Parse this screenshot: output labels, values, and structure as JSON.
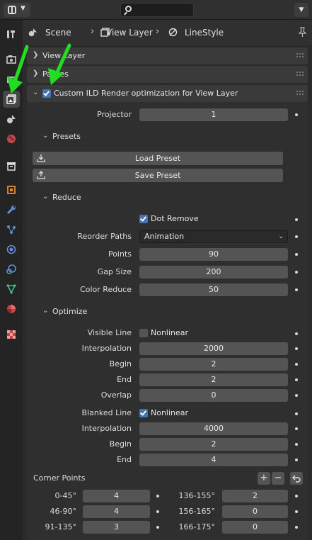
{
  "breadcrumb": {
    "scene": "Scene",
    "view_layer": "View Layer",
    "linestyle": "LineStyle"
  },
  "panels": {
    "view_layer": "View Layer",
    "passes": "Passes",
    "custom": "Custom ILD Render optimization for View Layer"
  },
  "projector": {
    "label": "Projector",
    "value": "1"
  },
  "presets": {
    "header": "Presets",
    "load": "Load Preset",
    "save": "Save Preset"
  },
  "reduce": {
    "header": "Reduce",
    "dot_remove": "Dot Remove",
    "reorder_label": "Reorder Paths",
    "reorder_value": "Animation",
    "points_label": "Points",
    "points_value": "90",
    "gap_label": "Gap Size",
    "gap_value": "200",
    "color_label": "Color Reduce",
    "color_value": "50"
  },
  "optimize": {
    "header": "Optimize",
    "visible_label": "Visible Line",
    "visible_nonlinear": "Nonlinear",
    "interp1_label": "Interpolation",
    "interp1_value": "2000",
    "begin1_label": "Begin",
    "begin1_value": "2",
    "end1_label": "End",
    "end1_value": "2",
    "overlap_label": "Overlap",
    "overlap_value": "0",
    "blanked_label": "Blanked Line",
    "blanked_nonlinear": "Nonlinear",
    "interp2_label": "Interpolation",
    "interp2_value": "4000",
    "begin2_label": "Begin",
    "begin2_value": "2",
    "end2_label": "End",
    "end2_value": "4"
  },
  "corner_points": {
    "header": "Corner Points",
    "add": "+",
    "remove": "−",
    "rows": [
      {
        "l_label": "0-45°",
        "l_value": "4",
        "r_label": "136-155°",
        "r_value": "2"
      },
      {
        "l_label": "46-90°",
        "l_value": "4",
        "r_label": "156-165°",
        "r_value": "0"
      },
      {
        "l_label": "91-135°",
        "l_value": "3",
        "r_label": "166-175°",
        "r_value": "0"
      }
    ]
  },
  "colors": {
    "accent": "#4772b3",
    "arrow": "#22dd22",
    "field": "#545454"
  }
}
